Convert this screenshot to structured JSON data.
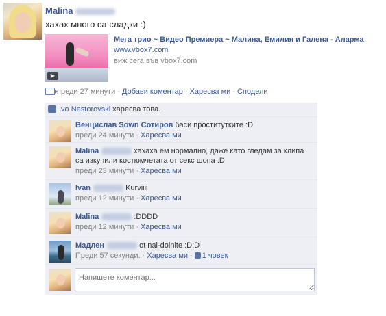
{
  "post": {
    "author_name": "Malina",
    "status_text": "хахах много са сладки :)",
    "attachment": {
      "title": "Мега трио ~ Видео Премиера ~ Малина, Емилия и Галена - Аларма",
      "domain": "www.vbox7.com",
      "caption": "виж сега във vbox7.com"
    },
    "actions": {
      "time": "преди 27 минути",
      "add_comment": "Добави коментар",
      "like": "Харесва ми",
      "share": "Сподели",
      "icon": "video-icon"
    }
  },
  "likes": {
    "liker": "Ivo Nestorovski",
    "text": "харесва това."
  },
  "comments": [
    {
      "name": "Венцислав Sown Сотиров",
      "text": "баси проституткитe :D",
      "time": "преди 24 минути",
      "like_label": "Харесва ми"
    },
    {
      "name": "Malina",
      "text": "хахаха ем нормално, даже като гледам за клипа са изкупили костюмчетата от секс шопа :D",
      "time": "преди 23 минути",
      "like_label": "Харесва ми"
    },
    {
      "name": "Ivan",
      "text": "Kurviiii",
      "time": "преди 12 минути",
      "like_label": "Харесва ми"
    },
    {
      "name": "Malina",
      "text": ":DDDD",
      "time": "преди 12 минути",
      "like_label": "Харесва ми"
    },
    {
      "name": "Мадлен",
      "text": "ot nai-dolnite :D:D",
      "time": "Преди 57 секунди.",
      "like_label": "Харесва ми",
      "like_count": "1 човек"
    }
  ],
  "composer": {
    "placeholder": "Напишете коментар..."
  },
  "colors": {
    "link": "#3b5998",
    "ufi_background": "#edeff4",
    "meta_gray": "#808080"
  }
}
